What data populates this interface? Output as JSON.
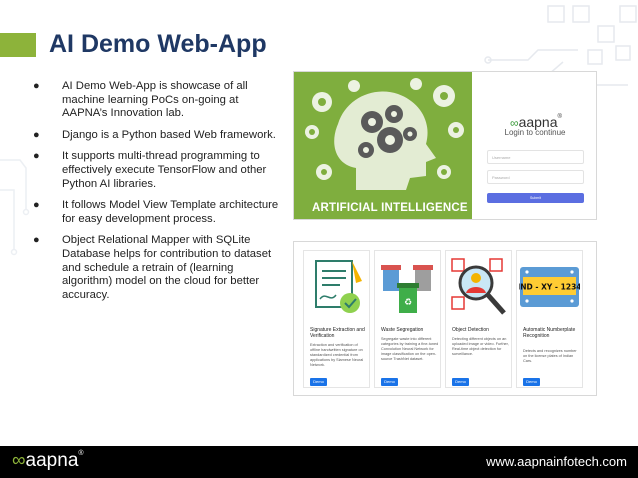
{
  "slide": {
    "title": "AI Demo Web-App",
    "bullets": [
      "AI Demo Web-App is showcase of all machine learning PoCs on-going at AAPNA’s Innovation lab.",
      "Django is a Python based Web framework.",
      "It supports multi-thread programming to effectively execute TensorFlow and other Python AI libraries.",
      "It follows Model View Template architecture for easy development process.",
      "Object Relational Mapper with SQLite Database helps for contribution to dataset and schedule a retrain of (learning algorithm) model on the cloud for better accuracy."
    ]
  },
  "login_screenshot": {
    "banner_text": "ARTIFICIAL INTELLIGENCE",
    "logo_text": "aapna",
    "logo_reg": "®",
    "subtitle": "Login to continue",
    "username_placeholder": "Username",
    "password_placeholder": "Password",
    "button_label": "Submit"
  },
  "demo_cards": [
    {
      "title": "Signature Extraction and Verification",
      "description": "Extraction and verification of offline handwritten signature on standardized credential from applications by Siamese Neural Network.",
      "button": "Demo"
    },
    {
      "title": "Waste Segregation",
      "description": "Segregate waste into different categories by training a fine-tuned Convolution Neural Network for image classification on the open-source TrashNet dataset.",
      "button": "Demo"
    },
    {
      "title": "Object Detection",
      "description": "Detecting different objects on an uploaded image or video. Further, Real-time object detection for surveillance.",
      "button": "Demo"
    },
    {
      "title": "Automatic Numberplate Recognition",
      "description": "Detects and recognizes number on the license plates of Indian Cars.",
      "button": "Demo",
      "plate_text": "IND - XY - 1234"
    }
  ],
  "footer": {
    "logo_text": "aapna",
    "logo_reg": "®",
    "url": "www.aapnainfotech.com"
  },
  "colors": {
    "title": "#1f3864",
    "accent_green": "#8db33a",
    "ai_green": "#7fae3e",
    "login_button": "#5b6ee1",
    "demo_button": "#1a73e8",
    "footer": "#000000"
  }
}
